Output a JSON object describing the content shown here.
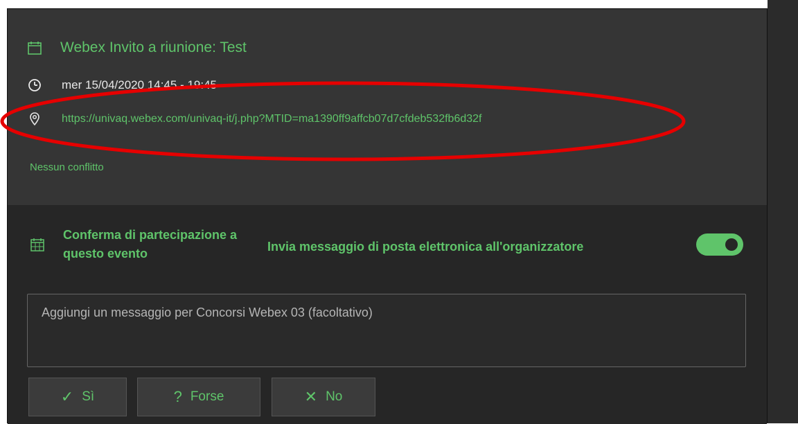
{
  "event": {
    "title": "Webex Invito a riunione: Test",
    "datetime": "mer 15/04/2020 14:45 - 19:45",
    "location_link": "https://univaq.webex.com/univaq-it/j.php?MTID=ma1390ff9affcb07d7cfdeb532fb6d32f",
    "conflict_status": "Nessun conflitto"
  },
  "rsvp": {
    "title": "Conferma di partecipazione a questo evento",
    "email_organizer_label": "Invia messaggio di posta elettronica all'organizzatore",
    "email_organizer_toggle": "on",
    "message_placeholder": "Aggiungi un messaggio per Concorsi Webex 03 (facoltativo)",
    "buttons": {
      "yes": "Sì",
      "maybe": "Forse",
      "no": "No"
    }
  },
  "icons": {
    "title": "calendar-icon",
    "time": "clock-icon",
    "location": "location-pin-icon",
    "rsvp": "calendar-grid-icon",
    "yes": "check-icon",
    "maybe": "question-icon",
    "no": "x-icon"
  },
  "colors": {
    "accent": "#5fc46a",
    "annotation": "#e60000"
  }
}
